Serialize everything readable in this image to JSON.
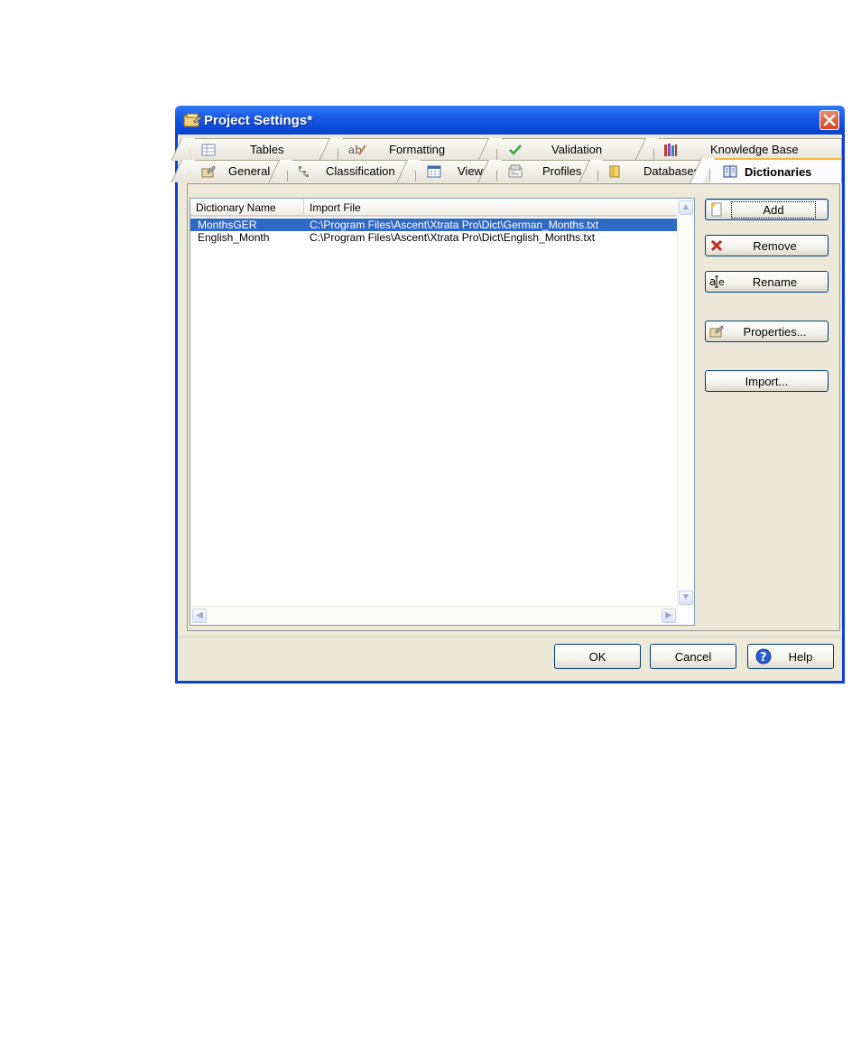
{
  "window": {
    "title": "Project Settings*"
  },
  "tabs": {
    "back_row": [
      {
        "label": "Tables",
        "icon": "table-icon"
      },
      {
        "label": "Formatting",
        "icon": "formatting-icon"
      },
      {
        "label": "Validation",
        "icon": "checkmark-icon"
      },
      {
        "label": "Knowledge Base",
        "icon": "books-icon"
      }
    ],
    "front_row": [
      {
        "label": "General",
        "icon": "general-icon"
      },
      {
        "label": "Classification",
        "icon": "tree-icon"
      },
      {
        "label": "Views",
        "icon": "views-icon"
      },
      {
        "label": "Profiles",
        "icon": "profiles-icon"
      },
      {
        "label": "Databases",
        "icon": "database-icon"
      },
      {
        "label": "Dictionaries",
        "icon": "dictionary-icon",
        "active": true
      }
    ]
  },
  "dictionaries": {
    "columns": [
      "Dictionary Name",
      "Import File"
    ],
    "rows": [
      {
        "name": "MonthsGER",
        "file": "C:\\Program Files\\Ascent\\Xtrata Pro\\Dict\\German_Months.txt",
        "selected": true
      },
      {
        "name": "English_Month",
        "file": "C:\\Program Files\\Ascent\\Xtrata Pro\\Dict\\English_Months.txt",
        "selected": false
      }
    ]
  },
  "side_buttons": {
    "add": "Add",
    "remove": "Remove",
    "rename": "Rename",
    "properties": "Properties...",
    "import": "Import..."
  },
  "footer": {
    "ok": "OK",
    "cancel": "Cancel",
    "help": "Help"
  },
  "colors": {
    "titlebar": "#0a49d8",
    "selection": "#316ac5",
    "active_tab_accent": "#f1b53c",
    "close_button": "#d5461f"
  }
}
